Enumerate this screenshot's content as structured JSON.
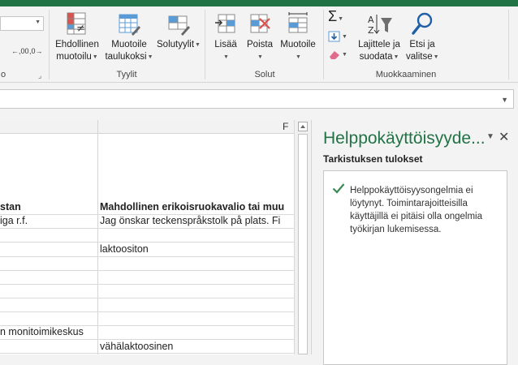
{
  "ribbon": {
    "groups": {
      "styles_label": "Tyylit",
      "cells_label": "Solut",
      "editing_label": "Muokkaaminen"
    },
    "buttons": {
      "conditional_line1": "Ehdollinen",
      "conditional_line2": "muotoilu",
      "format_table_line1": "Muotoile",
      "format_table_line2": "taulukoksi",
      "cell_styles_line1": "Solutyylit",
      "insert": "Lisää",
      "delete": "Poista",
      "format": "Muotoile",
      "sort_filter_line1": "Lajittele ja",
      "sort_filter_line2": "suodata",
      "find_select_line1": "Etsi ja",
      "find_select_line2": "valitse"
    },
    "decimal_buttons": [
      ",00",
      ",0"
    ],
    "colors": {
      "accent": "#217346"
    }
  },
  "grid": {
    "column_header": "F",
    "cells": {
      "r1_a": "stan",
      "r1_b": "Mahdollinen erikoisruokavalio tai muu",
      "r2_a": "iga r.f.",
      "r2_b": "Jag önskar teckenspråkstolk på plats. Fi",
      "r4_b": "laktoositon",
      "r10_a": "n monitoimikeskus",
      "r11_b": "vähälaktoosinen"
    }
  },
  "pane": {
    "title": "Helppokäyttöisyyde...",
    "subtitle": "Tarkistuksen tulokset",
    "result": "Helppokäyttöisyysongelmia ei löytynyt. Toimintarajoitteisilla käyttäjillä ei pitäisi olla ongelmia työkirjan lukemisessa."
  }
}
